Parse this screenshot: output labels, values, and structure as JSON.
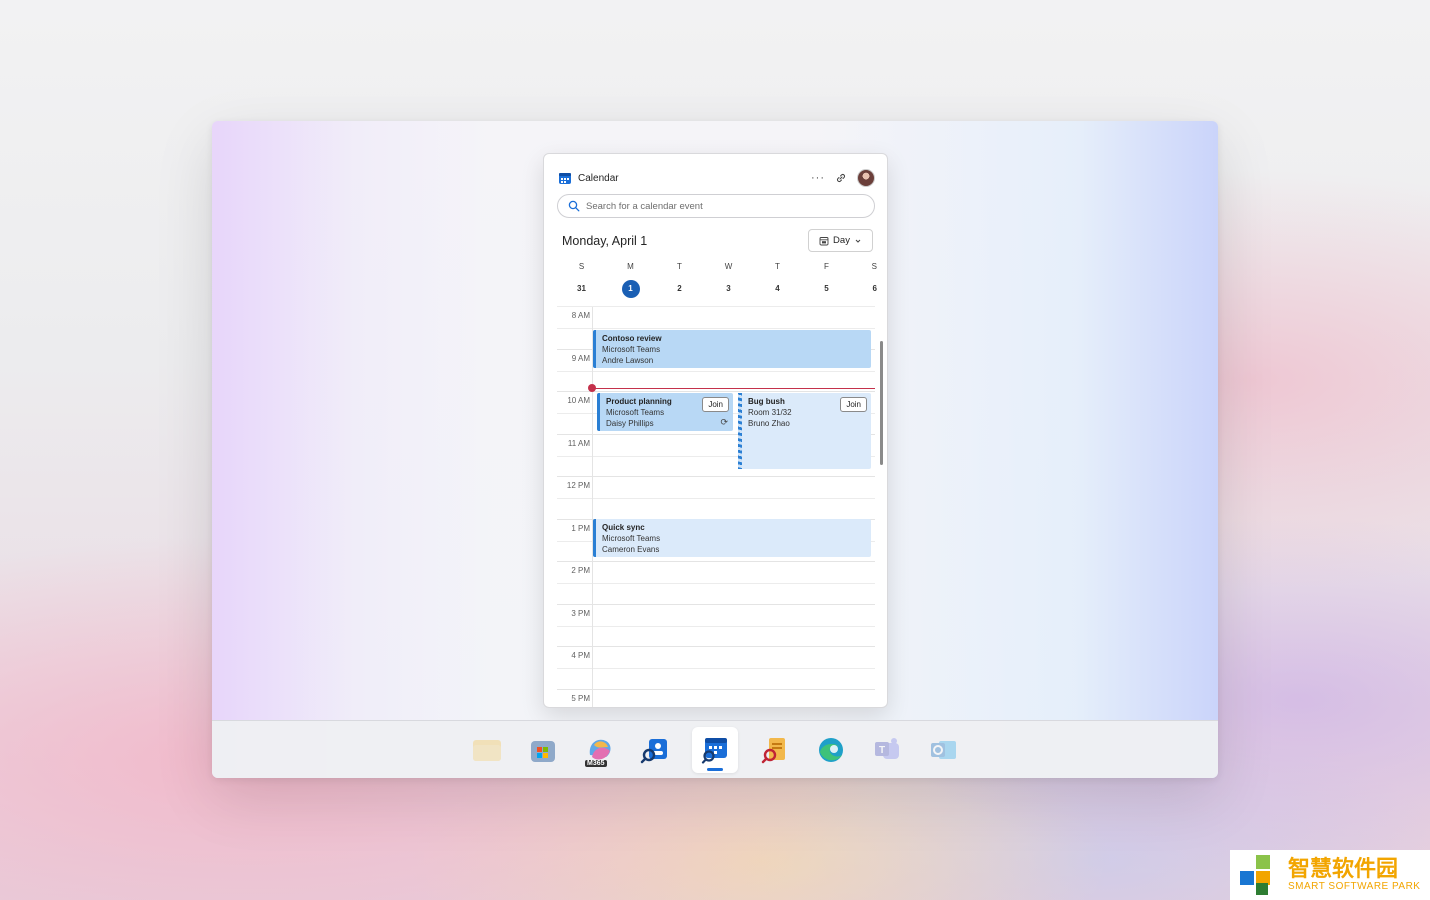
{
  "app": {
    "title": "Calendar"
  },
  "header": {
    "more_label": "···"
  },
  "search": {
    "placeholder": "Search for a calendar event"
  },
  "date_title": "Monday, April 1",
  "view_button": {
    "label": "Day"
  },
  "week": {
    "day_letters": [
      "S",
      "M",
      "T",
      "W",
      "T",
      "F",
      "S"
    ],
    "dates": [
      "31",
      "1",
      "2",
      "3",
      "4",
      "5",
      "6"
    ],
    "selected_index": 1
  },
  "hours": [
    "8 AM",
    "9 AM",
    "10 AM",
    "11 AM",
    "12 PM",
    "1 PM",
    "2 PM",
    "3 PM",
    "4 PM",
    "5 PM"
  ],
  "events": [
    {
      "title": "Contoso review",
      "location": "Microsoft Teams",
      "organizer": "Andre Lawson"
    },
    {
      "title": "Product planning",
      "location": "Microsoft Teams",
      "organizer": "Daisy Phillips",
      "action": "Join",
      "recurring_icon": "recurring-icon"
    },
    {
      "title": "Bug bush",
      "location": "Room 31/32",
      "organizer": "Bruno Zhao",
      "action": "Join"
    },
    {
      "title": "Quick sync",
      "location": "Microsoft Teams",
      "organizer": "Cameron Evans"
    }
  ],
  "taskbar": {
    "m365_badge": "M365",
    "icons": [
      "file-explorer-icon",
      "store-icon",
      "m365-copilot-icon",
      "people-search-icon",
      "calendar-search-icon",
      "file-search-icon",
      "edge-icon",
      "teams-icon",
      "outlook-icon"
    ]
  },
  "watermark": {
    "cn": "智慧软件园",
    "en": "SMART SOFTWARE PARK"
  },
  "colors": {
    "accent": "#1a5fb4",
    "now_line": "#c4314b",
    "event_fill": "#b8d8f5",
    "event_fill_light": "#dbeafa"
  }
}
